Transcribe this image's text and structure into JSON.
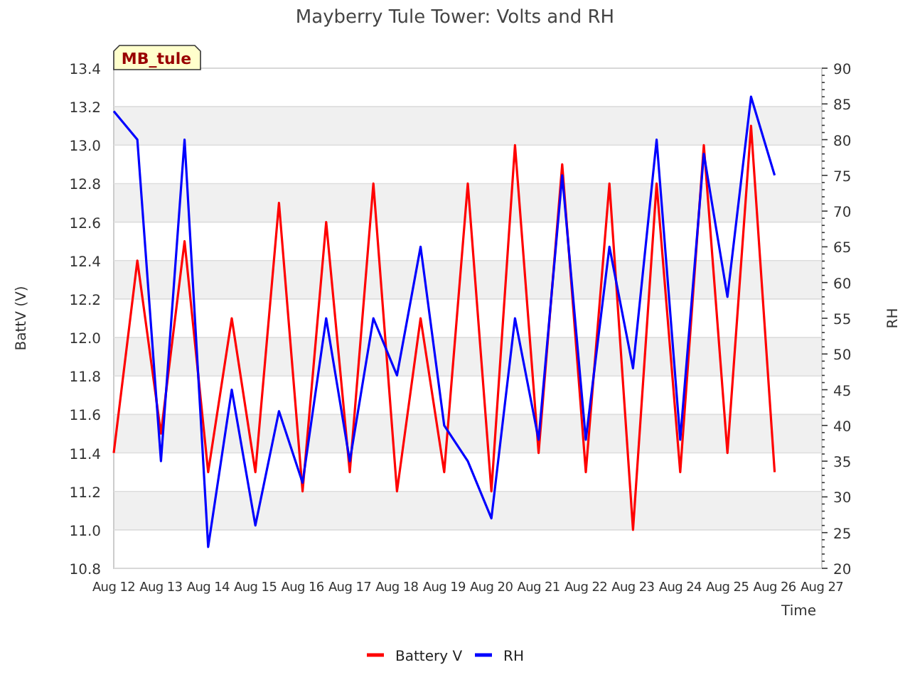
{
  "chart_data": {
    "type": "line",
    "title": "Mayberry Tule Tower: Volts and RH",
    "xlabel": "Time",
    "ylabel": "BattV (V)",
    "y2label": "RH",
    "categories": [
      "Aug 12",
      null,
      "Aug 13",
      null,
      "Aug 14",
      null,
      "Aug 15",
      null,
      "Aug 16",
      null,
      "Aug 17",
      null,
      "Aug 18",
      null,
      "Aug 19",
      null,
      "Aug 20",
      null,
      "Aug 21",
      null,
      "Aug 22",
      null,
      "Aug 23",
      null,
      "Aug 24",
      null,
      "Aug 25",
      null,
      "Aug 26",
      null,
      "Aug 27"
    ],
    "ylim": [
      10.8,
      13.4
    ],
    "y2lim": [
      20,
      90
    ],
    "yticks": [
      {
        "value": 10.8,
        "label": "10.8"
      },
      {
        "value": 11.0,
        "label": "11.0"
      },
      {
        "value": 11.2,
        "label": "11.2"
      },
      {
        "value": 11.4,
        "label": "11.4"
      },
      {
        "value": 11.6,
        "label": "11.6"
      },
      {
        "value": 11.8,
        "label": "11.8"
      },
      {
        "value": 12.0,
        "label": "12.0"
      },
      {
        "value": 12.2,
        "label": "12.2"
      },
      {
        "value": 12.4,
        "label": "12.4"
      },
      {
        "value": 12.6,
        "label": "12.6"
      },
      {
        "value": 12.8,
        "label": "12.8"
      },
      {
        "value": 13.0,
        "label": "13.0"
      },
      {
        "value": 13.2,
        "label": "13.2"
      },
      {
        "value": 13.4,
        "label": "13.4"
      }
    ],
    "y2ticks": [
      20,
      25,
      30,
      35,
      40,
      45,
      50,
      55,
      60,
      65,
      70,
      75,
      80,
      85,
      90
    ],
    "series": [
      {
        "name": "Battery V",
        "color": "#ff0000",
        "values": [
          11.4,
          12.4,
          11.5,
          12.5,
          11.3,
          12.1,
          11.3,
          12.7,
          11.2,
          12.6,
          11.3,
          12.8,
          11.2,
          12.1,
          11.3,
          12.8,
          11.2,
          13.0,
          11.4,
          12.9,
          11.3,
          12.8,
          11.0,
          12.8,
          11.3,
          13.0,
          11.4,
          13.1,
          11.3,
          null,
          null
        ]
      },
      {
        "name": "RH",
        "color": "#0000ff",
        "axis": "y2",
        "values": [
          84,
          80,
          35,
          80,
          23,
          45,
          26,
          42,
          32,
          55,
          35,
          55,
          47,
          65,
          40,
          35,
          27,
          55,
          38,
          75,
          38,
          65,
          48,
          80,
          38,
          78,
          58,
          86,
          75,
          null,
          null
        ]
      }
    ],
    "annotations": [
      {
        "text": "MB_tule"
      }
    ],
    "grid": true,
    "legend": true
  }
}
